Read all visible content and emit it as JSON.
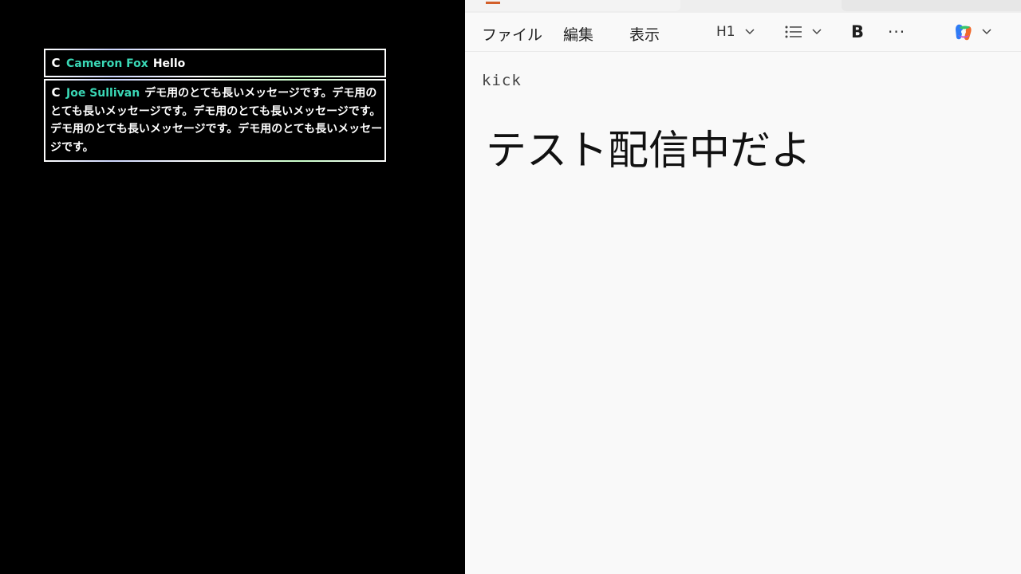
{
  "chat": {
    "messages": [
      {
        "platform_icon": "C",
        "user": "Cameron Fox",
        "text": "Hello"
      },
      {
        "platform_icon": "C",
        "user": "Joe Sullivan",
        "text": "デモ用のとても長いメッセージです。デモ用のとても長いメッセージです。デモ用のとても長いメッセージです。デモ用のとても長いメッセージです。デモ用のとても長いメッセージです。"
      }
    ]
  },
  "notepad": {
    "menu": {
      "file": "ファイル",
      "edit": "編集",
      "view": "表示"
    },
    "toolbar": {
      "heading": "H1",
      "bold": "B",
      "more": "···",
      "chevron": "⌵"
    },
    "editor": {
      "line1": "kick",
      "heading_line": "テスト配信中だよ"
    }
  },
  "colors": {
    "chat_username": "#3ad8b6",
    "tab_accent": "#d35f2a"
  }
}
